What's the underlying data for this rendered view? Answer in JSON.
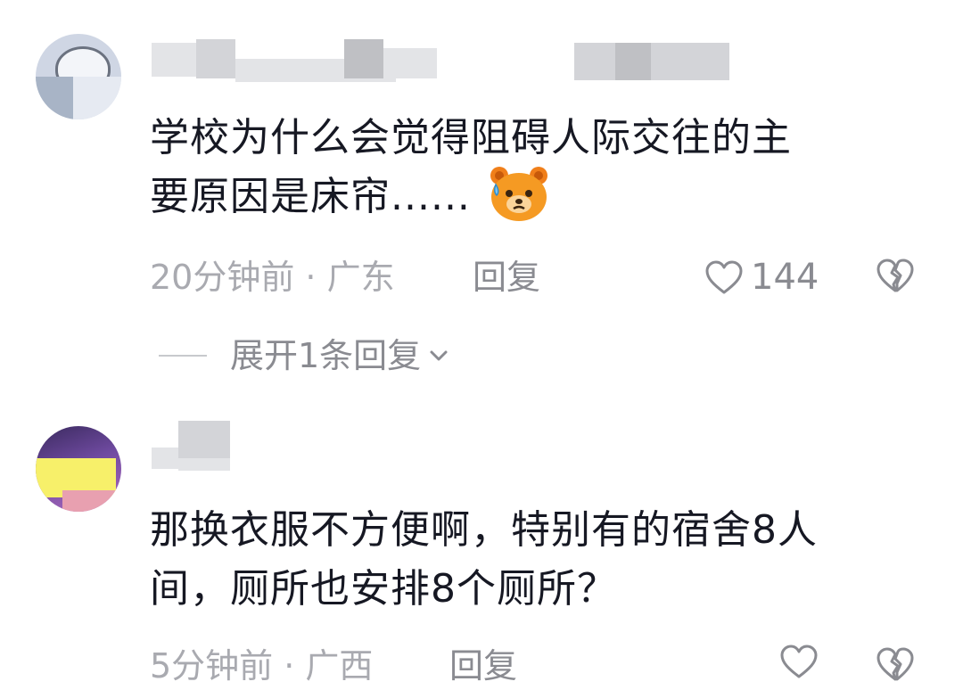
{
  "comments": [
    {
      "username": "",
      "text_line1": "学校为什么会觉得阻碍人际交往的主",
      "text_line2": "要原因是床帘......",
      "emoji": "sweating-bear-emoji",
      "time_location": "20分钟前 · 广东",
      "reply_label": "回复",
      "like_count": "144",
      "expand_replies": "展开1条回复"
    },
    {
      "username": "",
      "text_line1": "那换衣服不方便啊，特别有的宿舍8人",
      "text_line2": "间，厕所也安排8个厕所？",
      "time_location": "5分钟前 · 广西",
      "reply_label": "回复"
    }
  ],
  "icons": {
    "like": "heart-outline-icon",
    "dislike": "broken-heart-icon",
    "expand": "chevron-down-icon"
  },
  "colors": {
    "text": "#161823",
    "meta": "#a9aab0",
    "emoji_orange": "#f59a23"
  }
}
